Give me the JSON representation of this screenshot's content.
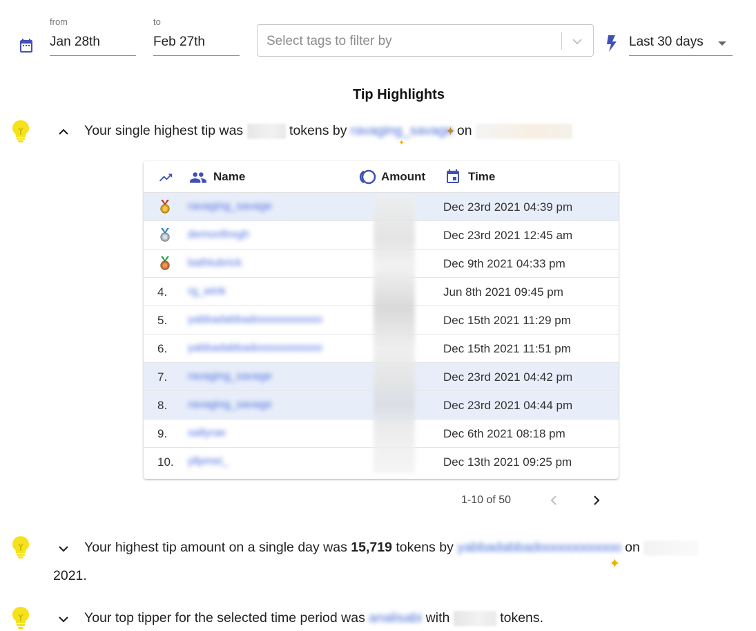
{
  "filters": {
    "from_label": "from",
    "from_value": "Jan 28th",
    "to_label": "to",
    "to_value": "Feb 27th",
    "tags_placeholder": "Select tags to filter by",
    "range_value": "Last 30 days"
  },
  "section_title": "Tip Highlights",
  "highlights": [
    {
      "pre": "Your single highest tip was",
      "mid": "tokens by",
      "user": "ravaging_savage",
      "post": "on",
      "expanded": true
    },
    {
      "pre": "Your highest tip amount on a single day was",
      "amount": "15,719",
      "mid": "tokens by",
      "user": "yabbadabbadooooooooooo",
      "post": "on",
      "line2": "2021.",
      "expanded": false
    },
    {
      "pre": "Your top tipper for the selected time period was",
      "user": "analisabi",
      "mid": "with",
      "post": "tokens.",
      "expanded": false
    }
  ],
  "table": {
    "headers": {
      "name": "Name",
      "amount": "Amount",
      "time": "Time"
    },
    "rows": [
      {
        "rank": "",
        "medal": "gold",
        "name": "ravaging_savage",
        "time": "Dec 23rd 2021 04:39 pm",
        "highlight": true
      },
      {
        "rank": "",
        "medal": "silver",
        "name": "demonfiregh",
        "time": "Dec 23rd 2021 12:45 am",
        "highlight": false
      },
      {
        "rank": "",
        "medal": "bronze",
        "name": "bathtubrick",
        "time": "Dec 9th 2021 04:33 pm",
        "highlight": false
      },
      {
        "rank": "4.",
        "medal": "",
        "name": "rg_wink",
        "time": "Jun 8th 2021 09:45 pm",
        "highlight": false
      },
      {
        "rank": "5.",
        "medal": "",
        "name": "yabbadabbadooooooooooo",
        "time": "Dec 15th 2021 11:29 pm",
        "highlight": false
      },
      {
        "rank": "6.",
        "medal": "",
        "name": "yabbadabbadooooooooooo",
        "time": "Dec 15th 2021 11:51 pm",
        "highlight": false
      },
      {
        "rank": "7.",
        "medal": "",
        "name": "ravaging_savage",
        "time": "Dec 23rd 2021 04:42 pm",
        "highlight": true
      },
      {
        "rank": "8.",
        "medal": "",
        "name": "ravaging_savage",
        "time": "Dec 23rd 2021 04:44 pm",
        "highlight": true
      },
      {
        "rank": "9.",
        "medal": "",
        "name": "sallyrae",
        "time": "Dec 6th 2021 08:18 pm",
        "highlight": false
      },
      {
        "rank": "10.",
        "medal": "",
        "name": "yllpmei_",
        "time": "Dec 13th 2021 09:25 pm",
        "highlight": false
      }
    ]
  },
  "pagination": {
    "range_text": "1-10 of 50"
  },
  "colors": {
    "accent": "#3f51b5",
    "link_blue": "#4d6fe0",
    "row_highlight": "#e8eef9",
    "bulb_yellow": "#f5e11c",
    "sparkle": "#e8b400"
  }
}
